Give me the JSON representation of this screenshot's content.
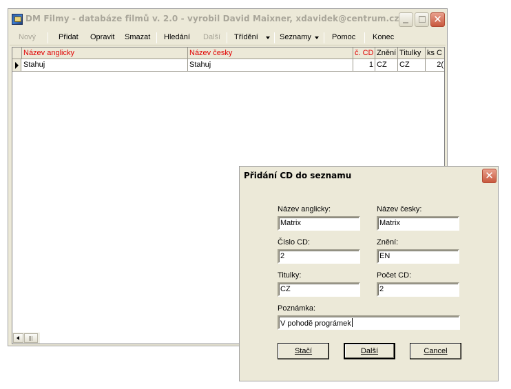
{
  "main_window": {
    "title": "DM Filmy - databáze filmů v. 2.0 - vyrobil David Maixner, xdavidek@centrum.cz"
  },
  "toolbar": {
    "new": "Nový",
    "add": "Přidat",
    "edit": "Opravit",
    "delete": "Smazat",
    "search": "Hledání",
    "next": "Další",
    "sort": "Třídění",
    "lists": "Seznamy",
    "help": "Pomoc",
    "exit": "Konec"
  },
  "grid": {
    "columns": [
      "Název anglicky",
      "Název česky",
      "č. CD",
      "Znění",
      "Titulky",
      "ks C"
    ],
    "rows": [
      [
        "Stahuj",
        "Stahuj",
        "1",
        "CZ",
        "CZ",
        "2("
      ]
    ]
  },
  "dialog": {
    "title": "Přidání CD do seznamu",
    "close_glyph": "✕",
    "labels": {
      "name_en": "Název anglicky:",
      "name_cz": "Název česky:",
      "cd_number": "Číslo CD:",
      "audio": "Znění:",
      "subtitles": "Titulky:",
      "cd_count": "Počet CD:",
      "note": "Poznámka:"
    },
    "values": {
      "name_en": "Matrix",
      "name_cz": "Matrix",
      "cd_number": "2",
      "audio": "EN",
      "subtitles": "CZ",
      "cd_count": "2",
      "note": "V pohodě prográmek"
    },
    "buttons": {
      "enough": "Stačí",
      "next": "Další",
      "cancel": "Cancel"
    }
  }
}
